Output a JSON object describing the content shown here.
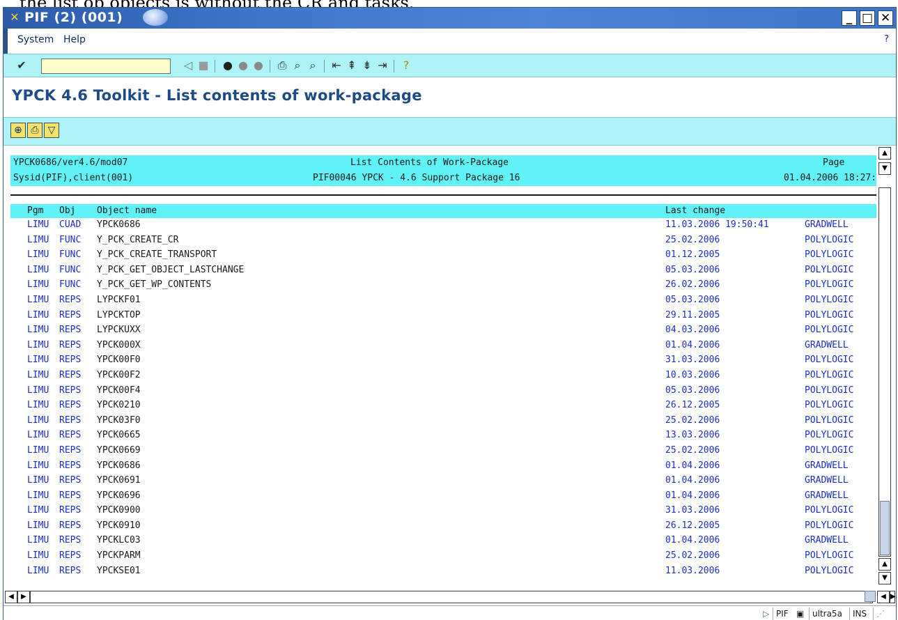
{
  "caption": "the list ob objects is without the CR and tasks.",
  "window": {
    "title": "PIF (2) (001)",
    "icon": "sap-logo-icon"
  },
  "menu": {
    "items": [
      "System",
      "Help"
    ],
    "help_mark": "?"
  },
  "toolbar": {
    "command_value": "",
    "icons": [
      "enter-check-icon",
      "back-arrow-icon",
      "save-icon",
      "back-green-icon",
      "exit-icon",
      "cancel-icon",
      "print-icon",
      "find-icon",
      "find-next-icon",
      "first-page-icon",
      "prev-page-icon",
      "next-page-icon",
      "last-page-icon",
      "help-icon"
    ]
  },
  "page": {
    "title": "YPCK 4.6 Toolkit - List contents of work-package"
  },
  "app_toolbar": {
    "buttons": [
      "select-detail-icon",
      "print-list-icon",
      "filter-icon"
    ]
  },
  "report_header": {
    "line1": {
      "left": "YPCK0686/ver4.6/mod07",
      "center": "List Contents of Work-Package",
      "right": "Page"
    },
    "line2": {
      "left": "Sysid(PIF),client(001)",
      "center": "PIF00046 YPCK - 4.6 Support Package 16",
      "right": "01.04.2006 18:27:"
    }
  },
  "list": {
    "columns": {
      "pgm": "Pgm",
      "obj": "Obj",
      "name": "Object name",
      "change": "Last change"
    },
    "rows": [
      {
        "pgm": "LIMU",
        "obj": "CUAD",
        "name": "YPCK0686",
        "date": "11.03.2006 19:50:41",
        "user": "GRADWELL"
      },
      {
        "pgm": "LIMU",
        "obj": "FUNC",
        "name": "Y_PCK_CREATE_CR",
        "date": "25.02.2006",
        "user": "POLYLOGIC"
      },
      {
        "pgm": "LIMU",
        "obj": "FUNC",
        "name": "Y_PCK_CREATE_TRANSPORT",
        "date": "01.12.2005",
        "user": "POLYLOGIC"
      },
      {
        "pgm": "LIMU",
        "obj": "FUNC",
        "name": "Y_PCK_GET_OBJECT_LASTCHANGE",
        "date": "05.03.2006",
        "user": "POLYLOGIC"
      },
      {
        "pgm": "LIMU",
        "obj": "FUNC",
        "name": "Y_PCK_GET_WP_CONTENTS",
        "date": "26.02.2006",
        "user": "POLYLOGIC"
      },
      {
        "pgm": "LIMU",
        "obj": "REPS",
        "name": "LYPCKF01",
        "date": "05.03.2006",
        "user": "POLYLOGIC"
      },
      {
        "pgm": "LIMU",
        "obj": "REPS",
        "name": "LYPCKTOP",
        "date": "29.11.2005",
        "user": "POLYLOGIC"
      },
      {
        "pgm": "LIMU",
        "obj": "REPS",
        "name": "LYPCKUXX",
        "date": "04.03.2006",
        "user": "POLYLOGIC"
      },
      {
        "pgm": "LIMU",
        "obj": "REPS",
        "name": "YPCK000X",
        "date": "01.04.2006",
        "user": "GRADWELL"
      },
      {
        "pgm": "LIMU",
        "obj": "REPS",
        "name": "YPCK00F0",
        "date": "31.03.2006",
        "user": "POLYLOGIC"
      },
      {
        "pgm": "LIMU",
        "obj": "REPS",
        "name": "YPCK00F2",
        "date": "10.03.2006",
        "user": "POLYLOGIC"
      },
      {
        "pgm": "LIMU",
        "obj": "REPS",
        "name": "YPCK00F4",
        "date": "05.03.2006",
        "user": "POLYLOGIC"
      },
      {
        "pgm": "LIMU",
        "obj": "REPS",
        "name": "YPCK0210",
        "date": "26.12.2005",
        "user": "POLYLOGIC"
      },
      {
        "pgm": "LIMU",
        "obj": "REPS",
        "name": "YPCK03F0",
        "date": "25.02.2006",
        "user": "POLYLOGIC"
      },
      {
        "pgm": "LIMU",
        "obj": "REPS",
        "name": "YPCK0665",
        "date": "13.03.2006",
        "user": "POLYLOGIC"
      },
      {
        "pgm": "LIMU",
        "obj": "REPS",
        "name": "YPCK0669",
        "date": "25.02.2006",
        "user": "POLYLOGIC"
      },
      {
        "pgm": "LIMU",
        "obj": "REPS",
        "name": "YPCK0686",
        "date": "01.04.2006",
        "user": "GRADWELL"
      },
      {
        "pgm": "LIMU",
        "obj": "REPS",
        "name": "YPCK0691",
        "date": "01.04.2006",
        "user": "GRADWELL"
      },
      {
        "pgm": "LIMU",
        "obj": "REPS",
        "name": "YPCK0696",
        "date": "01.04.2006",
        "user": "GRADWELL"
      },
      {
        "pgm": "LIMU",
        "obj": "REPS",
        "name": "YPCK0900",
        "date": "31.03.2006",
        "user": "POLYLOGIC"
      },
      {
        "pgm": "LIMU",
        "obj": "REPS",
        "name": "YPCK0910",
        "date": "26.12.2005",
        "user": "POLYLOGIC"
      },
      {
        "pgm": "LIMU",
        "obj": "REPS",
        "name": "YPCKLC03",
        "date": "01.04.2006",
        "user": "GRADWELL"
      },
      {
        "pgm": "LIMU",
        "obj": "REPS",
        "name": "YPCKPARM",
        "date": "25.02.2006",
        "user": "POLYLOGIC"
      },
      {
        "pgm": "LIMU",
        "obj": "REPS",
        "name": "YPCKSE01",
        "date": "11.03.2006",
        "user": "POLYLOGIC"
      }
    ]
  },
  "statusbar": {
    "system": "PIF",
    "server": "ultra5a",
    "mode": "INS"
  }
}
